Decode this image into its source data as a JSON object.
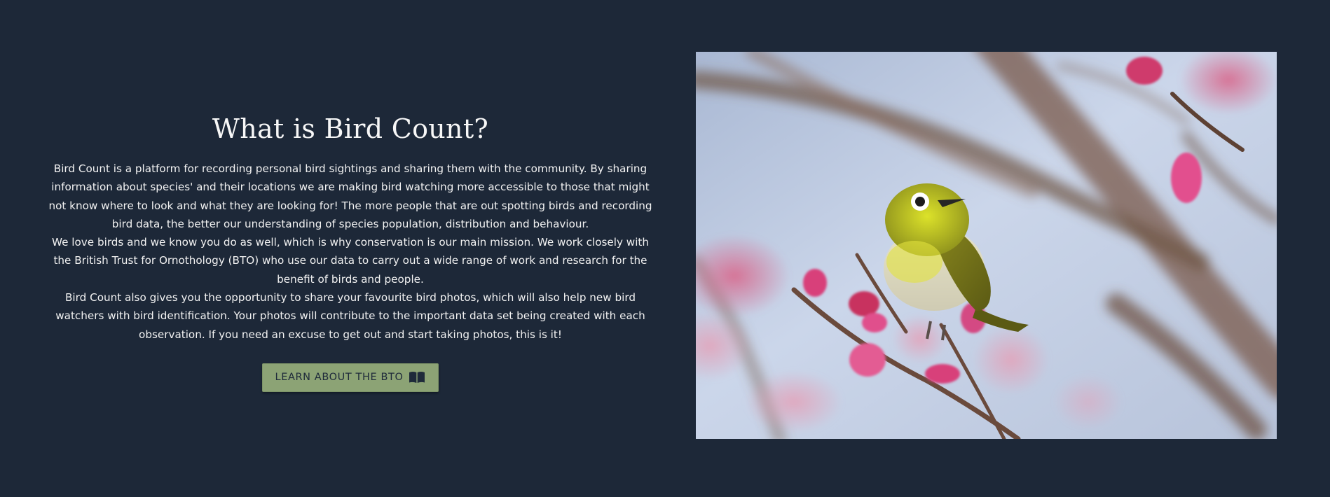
{
  "about": {
    "title": "What is Bird Count?",
    "paragraphs": [
      "Bird Count is a platform for recording personal bird sightings and sharing them with the community. By sharing information about species' and their locations we are making bird watching more accessible to those that might not know where to look and what they are looking for! The more people that are out spotting birds and recording bird data, the better our understanding of species population, distribution and behaviour.",
      "We love birds and we know you do as well, which is why conservation is our main mission. We work closely with the British Trust for Ornothology (BTO) who use our data to carry out a wide range of work and research for the benefit of birds and people.",
      "Bird Count also gives you the opportunity to share your favourite bird photos, which will also help new bird watchers with bird identification. Your photos will contribute to the important data set being created with each observation. If you need an excuse to get out and start taking photos, this is it!"
    ],
    "button_label": "LEARN ABOUT THE BTO",
    "button_icon": "book-open-icon"
  },
  "photo": {
    "subject": "bird-photo"
  },
  "colors": {
    "background": "#1d2838",
    "button": "#8ca375",
    "button_text": "#1e2a3a",
    "text": "#f2f2f2"
  }
}
